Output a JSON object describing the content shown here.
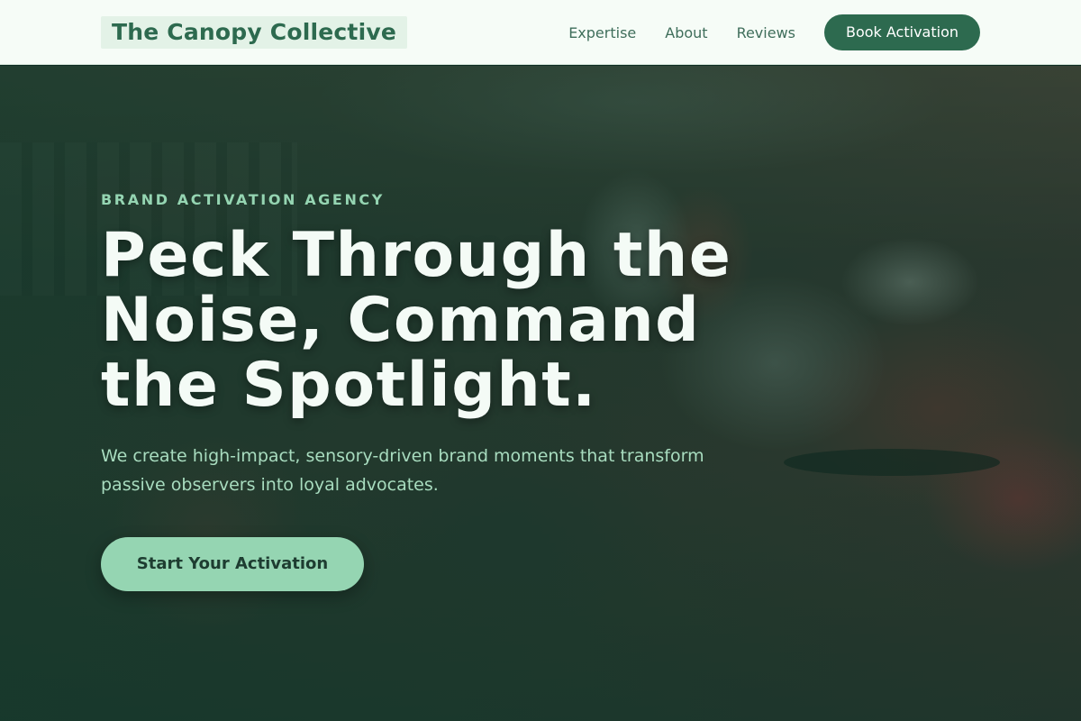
{
  "header": {
    "brand": "The Canopy Collective",
    "nav": [
      "Expertise",
      "About",
      "Reviews"
    ],
    "cta_label": "Book Activation"
  },
  "hero": {
    "eyebrow": "BRAND ACTIVATION AGENCY",
    "headline": "Peck Through the Noise, Command the Spotlight.",
    "subhead": "We create high-impact, sensory-driven brand moments that transform passive observers into loyal advocates.",
    "cta_label": "Start Your Activation"
  },
  "colors": {
    "brand_green": "#2d6a4f",
    "accent_mint": "#95d5b2",
    "header_bg": "#f6fcf7"
  }
}
